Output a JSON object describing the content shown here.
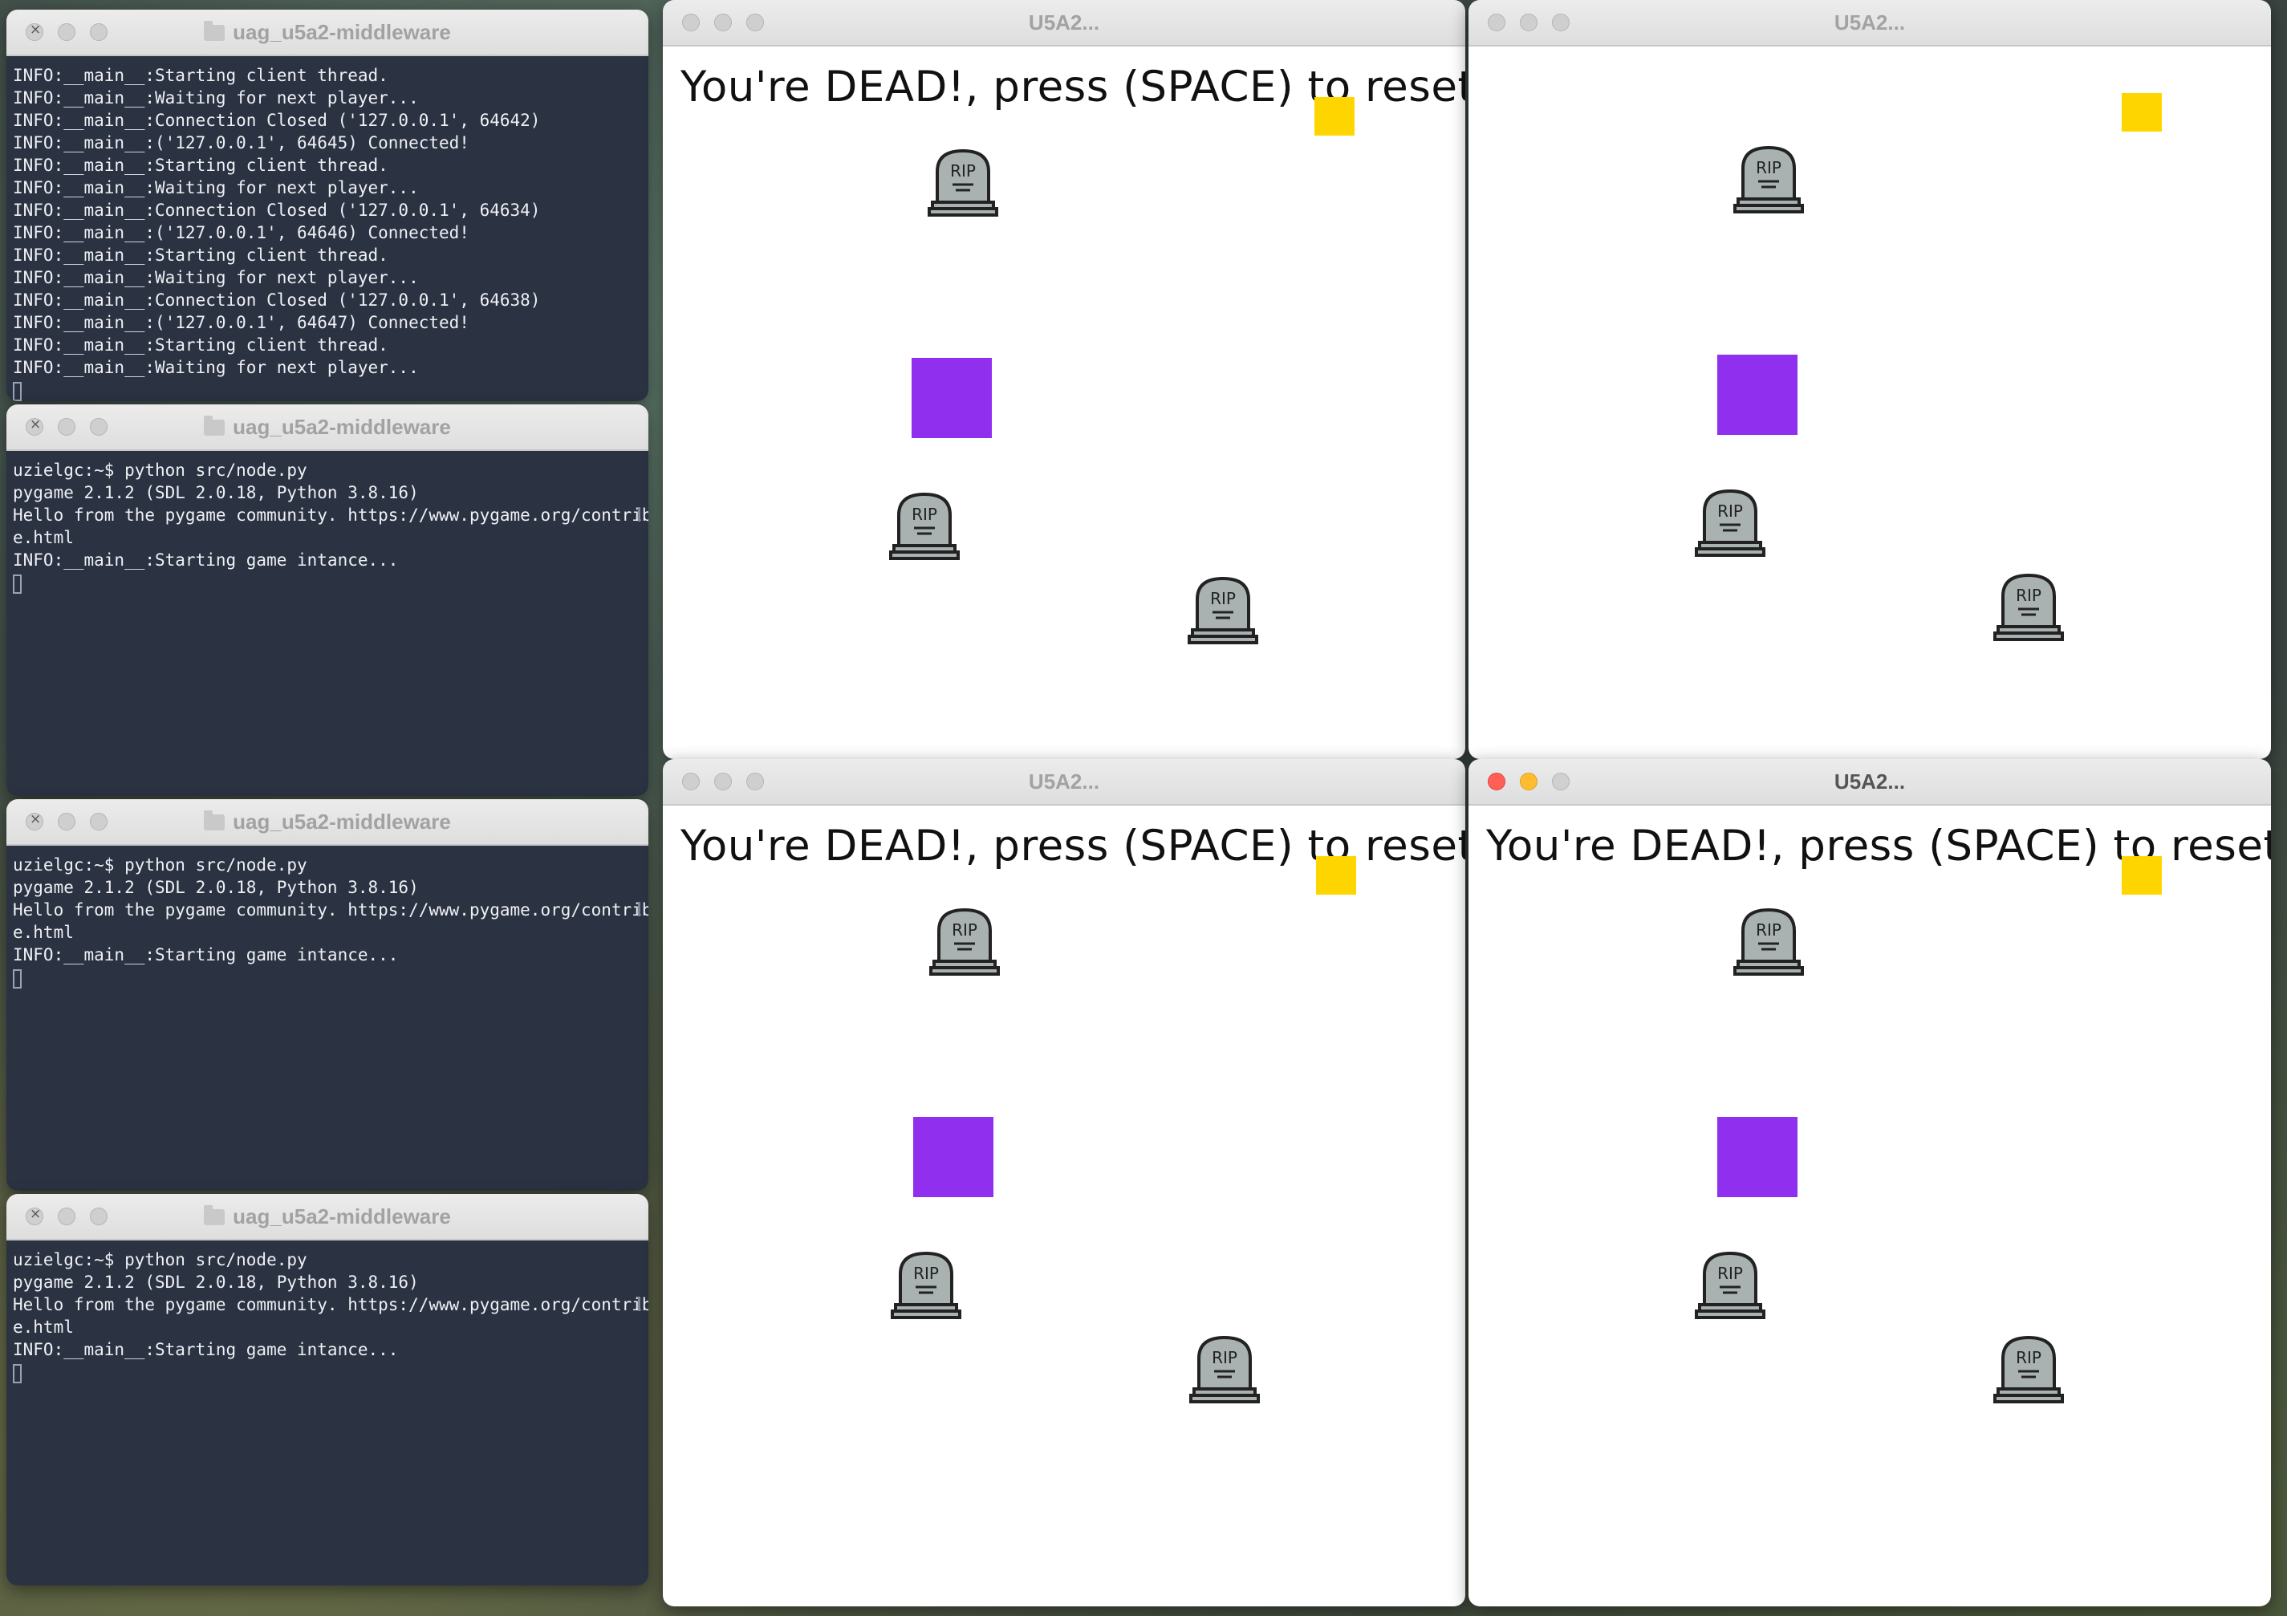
{
  "terminals": [
    {
      "title": "uag_u5a2-middleware",
      "lines": [
        "INFO:__main__:Starting client thread.",
        "INFO:__main__:Waiting for next player...",
        "INFO:__main__:Connection Closed ('127.0.0.1', 64642)",
        "INFO:__main__:('127.0.0.1', 64645) Connected!",
        "INFO:__main__:Starting client thread.",
        "INFO:__main__:Waiting for next player...",
        "INFO:__main__:Connection Closed ('127.0.0.1', 64634)",
        "INFO:__main__:('127.0.0.1', 64646) Connected!",
        "INFO:__main__:Starting client thread.",
        "INFO:__main__:Waiting for next player...",
        "INFO:__main__:Connection Closed ('127.0.0.1', 64638)",
        "INFO:__main__:('127.0.0.1', 64647) Connected!",
        "INFO:__main__:Starting client thread.",
        "INFO:__main__:Waiting for next player..."
      ]
    },
    {
      "title": "uag_u5a2-middleware",
      "lines": [
        "uzielgc:~$ python src/node.py",
        "pygame 2.1.2 (SDL 2.0.18, Python 3.8.16)",
        "Hello from the pygame community. https://www.pygame.org/contribut",
        "e.html",
        "INFO:__main__:Starting game intance..."
      ]
    },
    {
      "title": "uag_u5a2-middleware",
      "lines": [
        "uzielgc:~$ python src/node.py",
        "pygame 2.1.2 (SDL 2.0.18, Python 3.8.16)",
        "Hello from the pygame community. https://www.pygame.org/contribut",
        "e.html",
        "INFO:__main__:Starting game intance..."
      ]
    },
    {
      "title": "uag_u5a2-middleware",
      "lines": [
        "uzielgc:~$ python src/node.py",
        "pygame 2.1.2 (SDL 2.0.18, Python 3.8.16)",
        "Hello from the pygame community. https://www.pygame.org/contribut",
        "e.html",
        "INFO:__main__:Starting game intance..."
      ]
    }
  ],
  "games": [
    {
      "title": "U5A2...",
      "message": "You're DEAD!, press (SPACE) to reset.",
      "show_message": true,
      "active": false
    },
    {
      "title": "U5A2...",
      "message": "",
      "show_message": false,
      "active": false
    },
    {
      "title": "U5A2...",
      "message": "You're DEAD!, press (SPACE) to reset.",
      "show_message": true,
      "active": false
    },
    {
      "title": "U5A2...",
      "message": "You're DEAD!, press (SPACE) to reset.",
      "show_message": true,
      "active": true
    }
  ],
  "tombstone_label": "RIP",
  "colors": {
    "terminal_bg": "#2b3242",
    "terminal_text": "#eef0f4",
    "food": "#ffd500",
    "player": "#9030ee",
    "tombstone": "#a9b1b1",
    "close_light": "#ff5f57",
    "minimize_light": "#febc2e"
  }
}
